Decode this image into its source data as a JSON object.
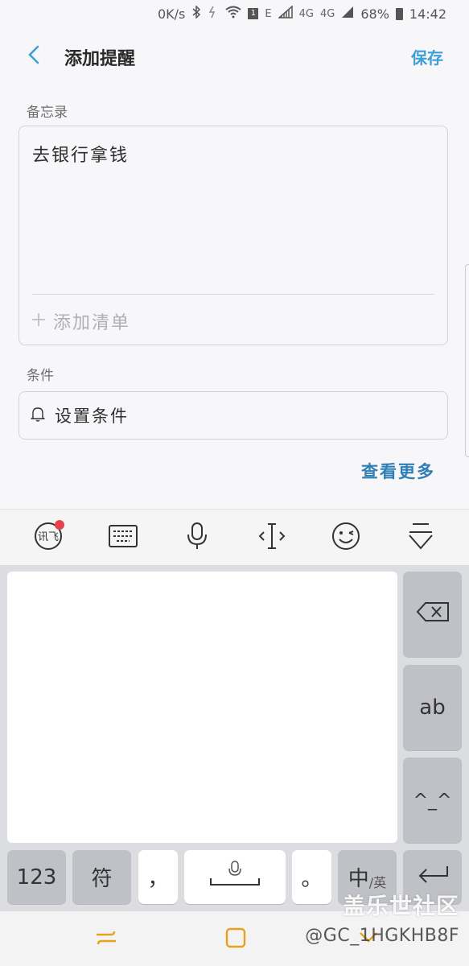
{
  "status_bar": {
    "speed": "0K/s",
    "sim_badge": "1",
    "net1": "E",
    "net2": "4G",
    "net3": "4G",
    "battery": "68%",
    "time": "14:42"
  },
  "header": {
    "title": "添加提醒",
    "save_label": "保存"
  },
  "memo": {
    "section_label": "备忘录",
    "text": "去银行拿钱",
    "add_list_label": "添加清单"
  },
  "condition": {
    "section_label": "条件",
    "set_label": "设置条件"
  },
  "view_more_label": "查看更多",
  "keyboard": {
    "toolbar_icons": [
      "xunfei-logo-icon",
      "keyboard-icon",
      "microphone-icon",
      "cursor-move-icon",
      "emoji-icon",
      "collapse-keyboard-icon"
    ],
    "keys": {
      "numbers": "123",
      "symbols": "符",
      "comma": "，",
      "period": "。",
      "lang_main": "中",
      "lang_alt": "/英",
      "ab": "ab",
      "kaomoji": "^_^"
    }
  },
  "watermark": {
    "line1": "盖乐世社区",
    "line2": "@GC_1HGKHB8F"
  },
  "colors": {
    "accent": "#3e9ed6",
    "link": "#2e7fb5",
    "notification_dot": "#e8414b"
  }
}
